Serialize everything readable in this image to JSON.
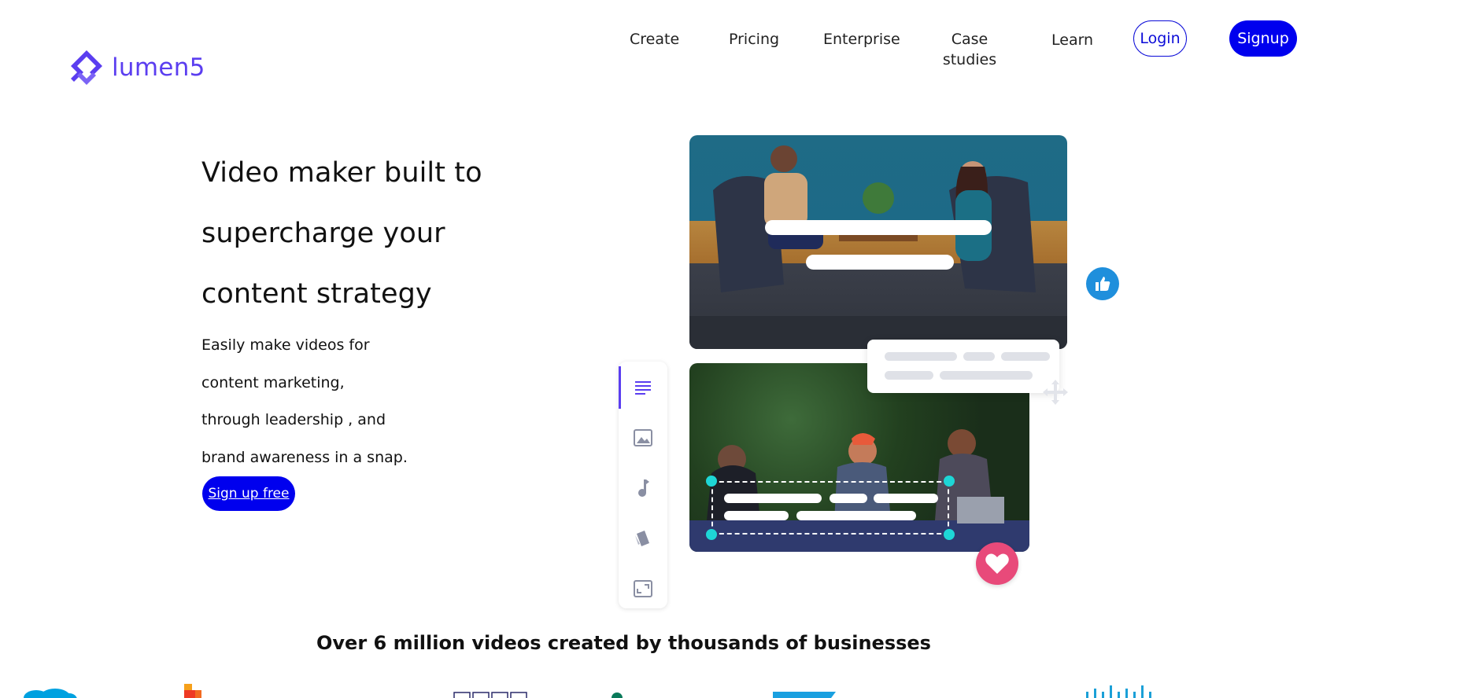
{
  "brand": {
    "name": "lumen5",
    "color": "#5b3ef0"
  },
  "nav": {
    "items": [
      {
        "label": "Create"
      },
      {
        "label": "Pricing"
      },
      {
        "label": "Enterprise"
      },
      {
        "label": "Case studies"
      },
      {
        "label": "Learn"
      }
    ],
    "login_label": "Login",
    "signup_label": "Signup"
  },
  "hero": {
    "headline_lines": [
      "Video maker built to",
      "supercharge your",
      "content strategy"
    ],
    "sub_lines": [
      "Easily make videos for",
      "content marketing,",
      "through leadership , and",
      "brand awareness in a snap."
    ],
    "cta_label": "Sign up free"
  },
  "tagline": "Over 6 million videos created by thousands of businesses",
  "colors": {
    "primary": "#0000ee",
    "accent": "#5b3ef0",
    "like": "#1f8fdc",
    "heart": "#e84a7a",
    "handle": "#1ed6d6"
  },
  "editor_icons": [
    "text-icon",
    "image-icon",
    "music-icon",
    "style-icon",
    "format-icon"
  ]
}
